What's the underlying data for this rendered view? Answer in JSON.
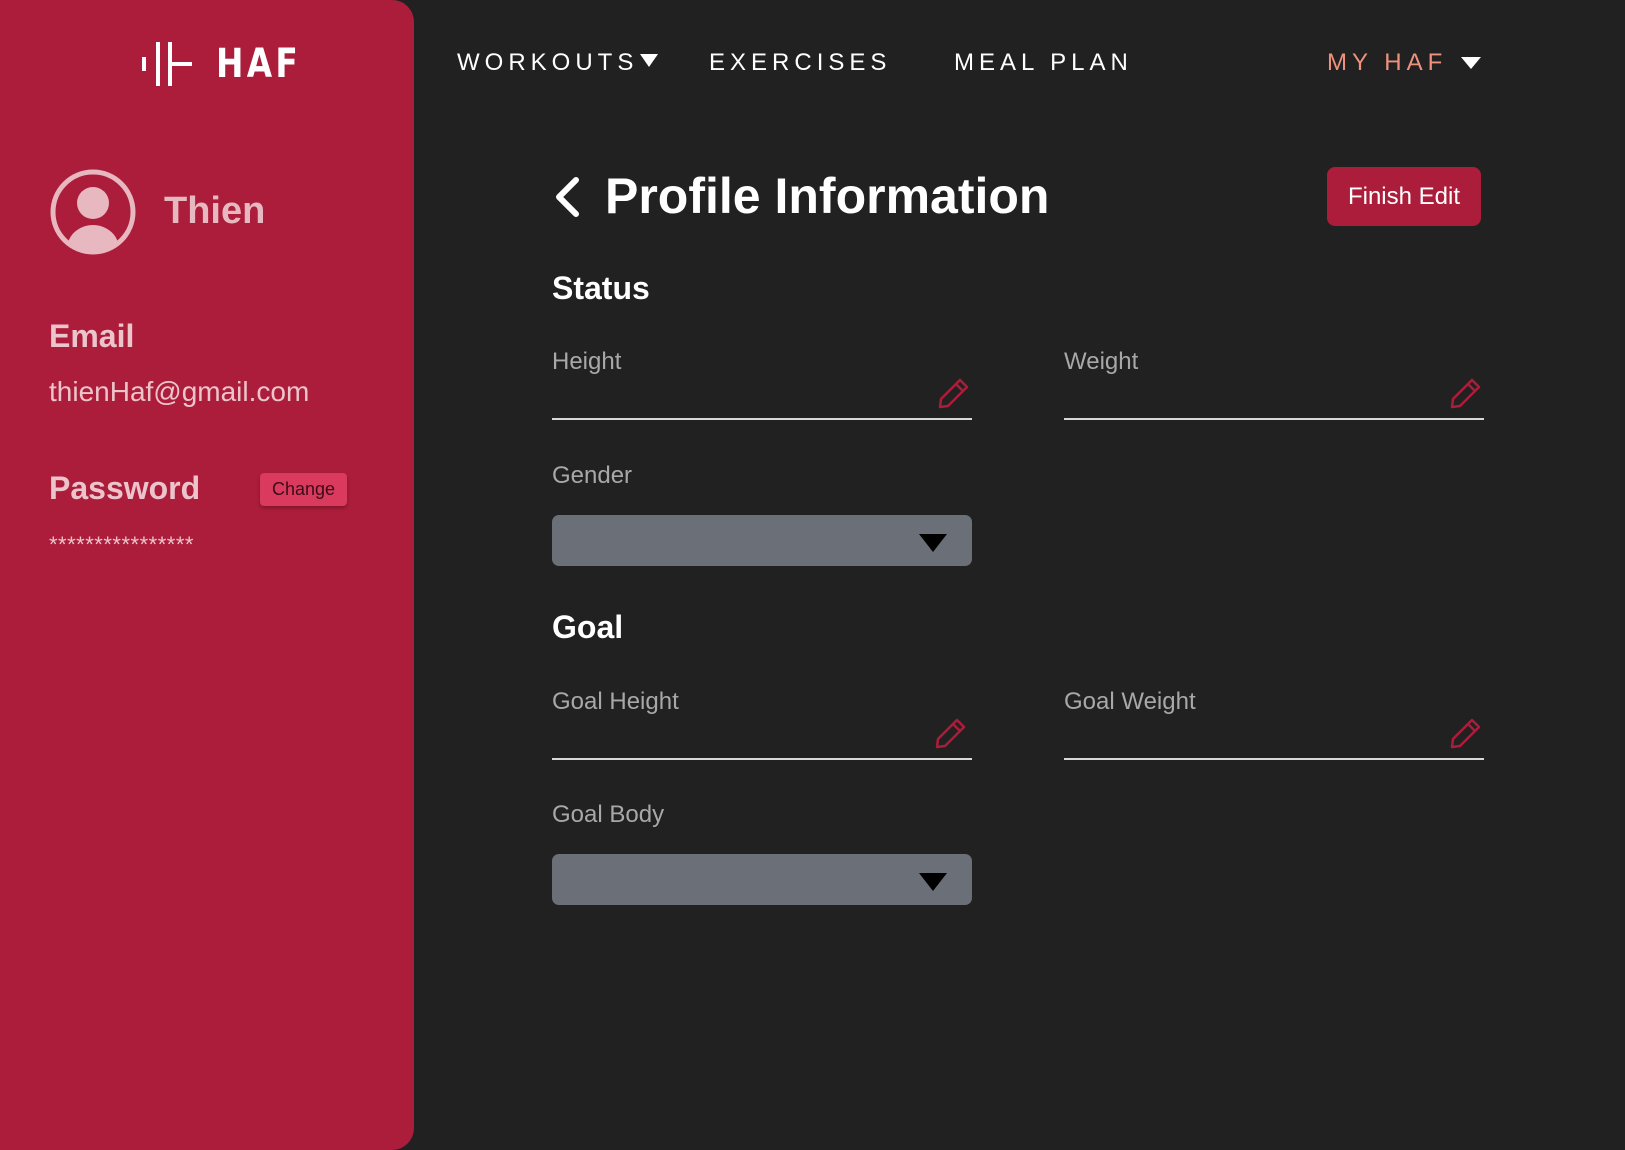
{
  "brand": {
    "name": "HAF"
  },
  "nav": {
    "workouts": "WORKOUTS",
    "exercises": "EXERCISES",
    "meal_plan": "MEAL PLAN",
    "my_haf": "MY HAF"
  },
  "profile": {
    "name": "Thien",
    "email_label": "Email",
    "email": "thienHaf@gmail.com",
    "password_label": "Password",
    "change_label": "Change",
    "password_mask": "****************"
  },
  "main": {
    "title": "Profile Information",
    "finish_label": "Finish Edit",
    "status_title": "Status",
    "goal_title": "Goal",
    "height_label": "Height",
    "weight_label": "Weight",
    "gender_label": "Gender",
    "gender_value": "",
    "goal_height_label": "Goal Height",
    "goal_weight_label": "Goal Weight",
    "goal_body_label": "Goal Body",
    "goal_body_value": ""
  },
  "colors": {
    "accent": "#ab1d3a",
    "background": "#212121",
    "active_nav": "#f0917e",
    "select_fill": "#6a6f78"
  },
  "icons": [
    "logo-mark-icon",
    "avatar-icon",
    "chevron-left-icon",
    "pencil-icon",
    "caret-down-icon"
  ]
}
